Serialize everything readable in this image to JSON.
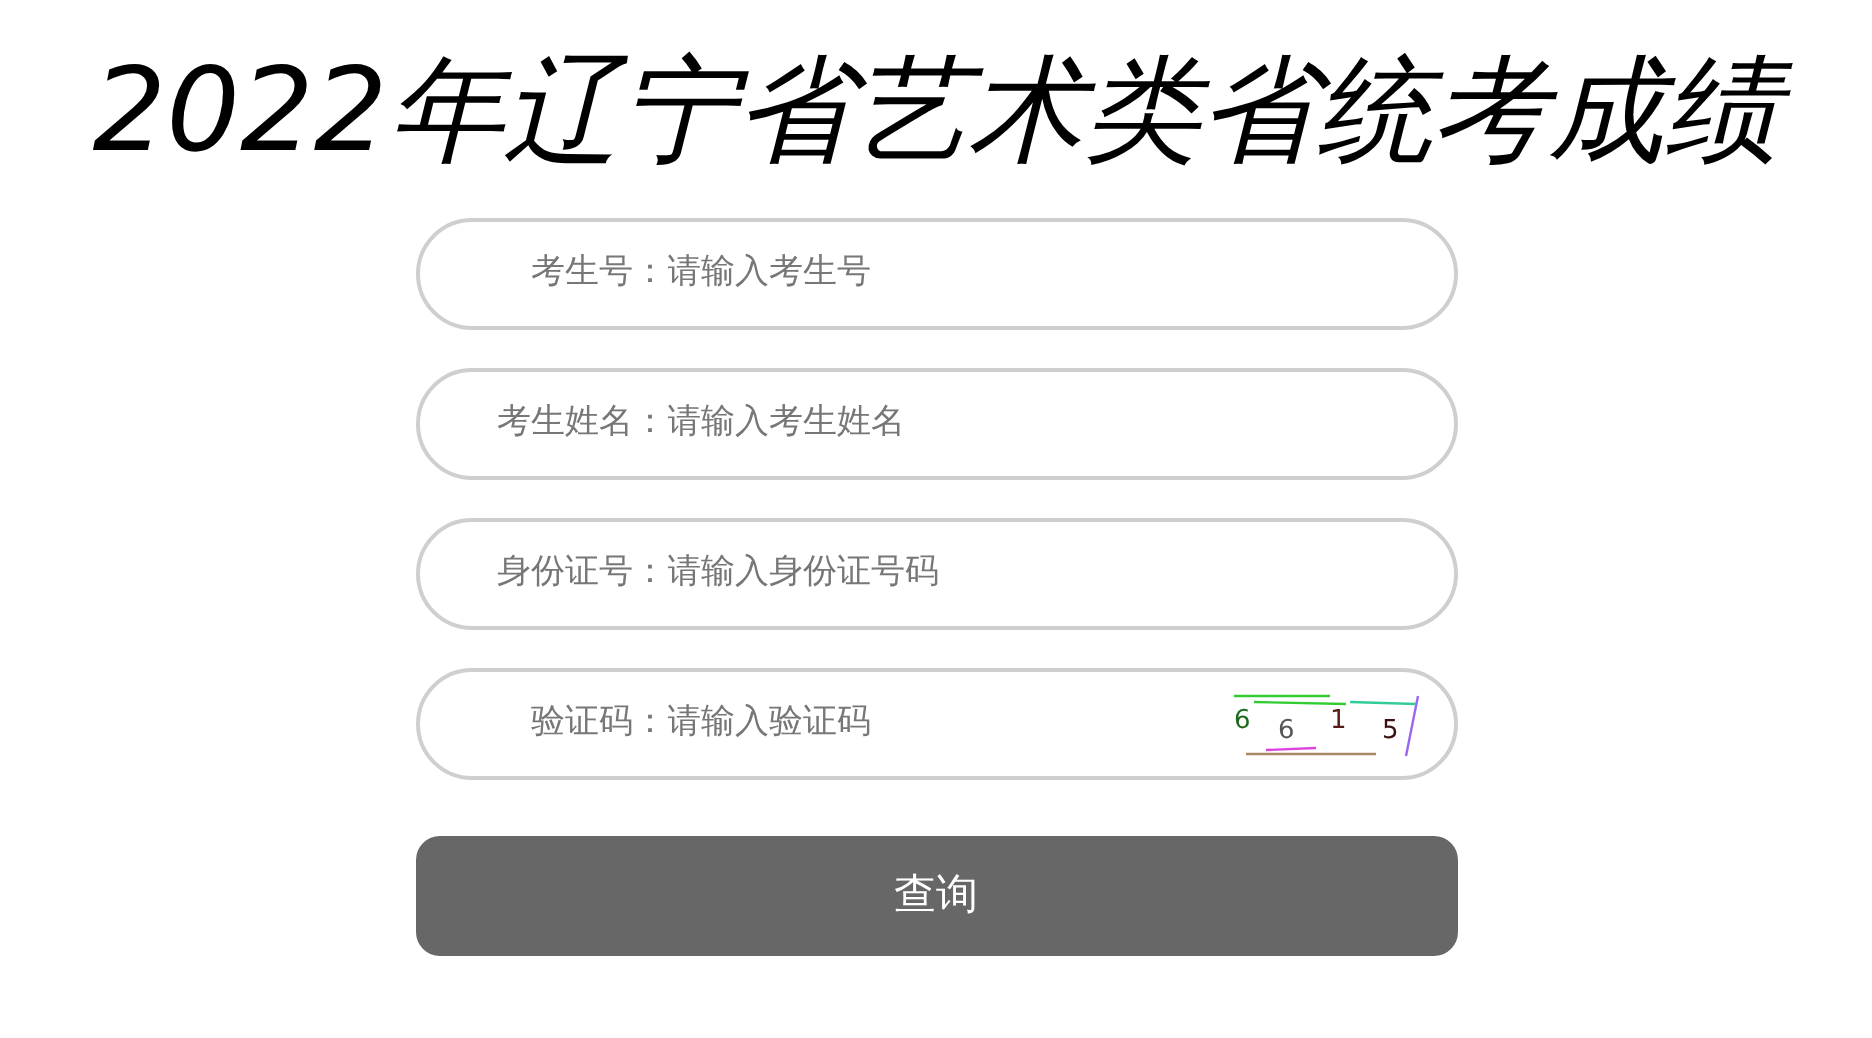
{
  "title": "2022年辽宁省艺术类省统考成绩",
  "fields": [
    {
      "label": "考生号：",
      "placeholder": "请输入考生号"
    },
    {
      "label": "考生姓名：",
      "placeholder": "请输入考生姓名"
    },
    {
      "label": "身份证号：",
      "placeholder": "请输入身份证号码"
    },
    {
      "label": "验证码：",
      "placeholder": "请输入验证码",
      "kind": "captcha"
    }
  ],
  "captcha": {
    "characters": [
      {
        "text": "6",
        "color": "#1a6a1a"
      },
      {
        "text": "6",
        "color": "#555555"
      },
      {
        "text": "1",
        "color": "#5a1a1a"
      },
      {
        "text": "5",
        "color": "#3a1010"
      }
    ]
  },
  "submit": {
    "label": "查询"
  }
}
